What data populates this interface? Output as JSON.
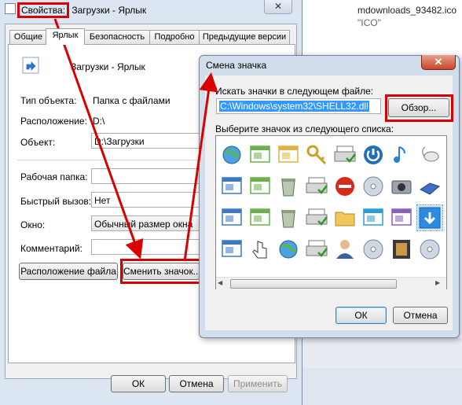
{
  "background": {
    "file_name": "mdownloads_93482.ico",
    "file_sub": "\"ICO\""
  },
  "properties_window": {
    "title_prefix": "Свойства:",
    "title_rest": " Загрузки - Ярлык",
    "close_glyph": "✕",
    "tabs": [
      {
        "label": "Общие"
      },
      {
        "label": "Ярлык"
      },
      {
        "label": "Безопасность"
      },
      {
        "label": "Подробно"
      },
      {
        "label": "Предыдущие версии"
      }
    ],
    "shortcut_name": "Загрузки - Ярлык",
    "object_type_label": "Тип объекта:",
    "object_type_value": "Папка с файлами",
    "location_label": "Расположение:",
    "location_value": "D:\\",
    "object_label": "Объект:",
    "object_value": "D:\\Загрузки",
    "workdir_label": "Рабочая папка:",
    "workdir_value": "",
    "hotkey_label": "Быстрый вызов:",
    "hotkey_value": "Нет",
    "window_label": "Окно:",
    "window_value": "Обычный размер окна",
    "comment_label": "Комментарий:",
    "comment_value": "",
    "file_location_button": "Расположение файла",
    "change_icon_button": "Сменить значок...",
    "ok_button": "ОК",
    "cancel_button": "Отмена",
    "apply_button": "Применить"
  },
  "change_icon_dialog": {
    "title": "Смена значка",
    "close_glyph": "✕",
    "search_label": "Искать значки в следующем файле:",
    "file_path": "C:\\Windows\\system32\\SHELL32.dll",
    "browse_button": "Обзор...",
    "select_label": "Выберите значок из следующего списка:",
    "ok_button": "ОК",
    "cancel_button": "Отмена",
    "icons": [
      "network-globe-icon",
      "window-pointer-icon",
      "document-cursor-icon",
      "keys-icon",
      "printer-network-icon",
      "power-icon",
      "music-note-icon",
      "mouse-icon",
      "window-list-icon",
      "picture-window-icon",
      "recycle-bin-full-icon",
      "fax-icon",
      "no-entry-icon",
      "dvd-icon",
      "camera-icon",
      "disk-drive-icon",
      "monitor-icon",
      "windows-stack-icon",
      "recycle-bin-empty-icon",
      "printer-check-icon",
      "folder-icon",
      "documents-icon",
      "media-icon",
      "download-arrow-icon",
      "grid-window-icon",
      "hand-pointer-icon",
      "globe-folder-icon",
      "printer-check2-icon",
      "user-icon",
      "key-cd-icon",
      "film-icon",
      "cd-network-icon"
    ],
    "colors": {
      "selection": "#3399ff",
      "annotation_red": "#d90000"
    }
  }
}
